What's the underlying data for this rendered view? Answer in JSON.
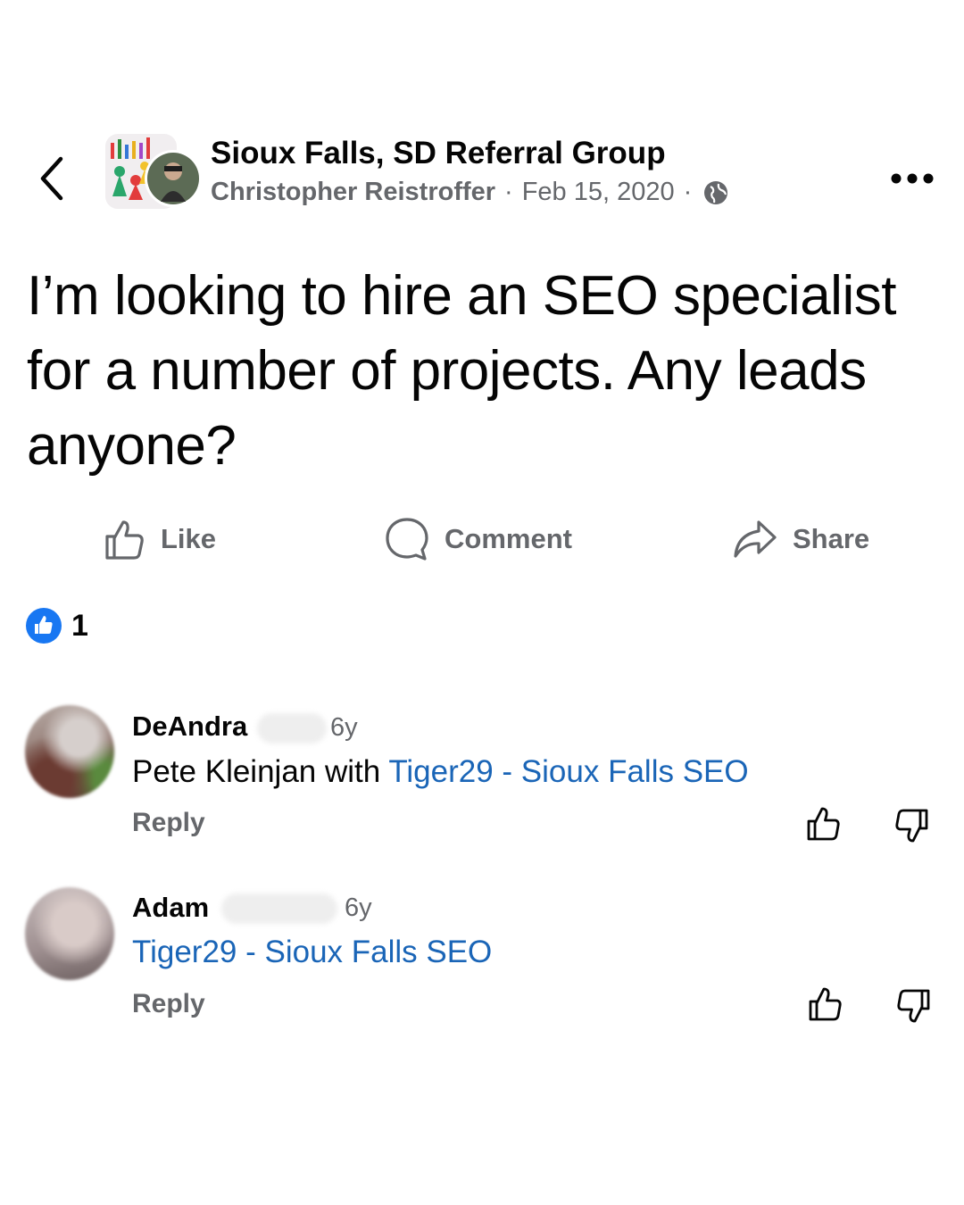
{
  "header": {
    "group_name": "Sioux Falls, SD Referral Group",
    "author": "Christopher Reistroffer",
    "separator": "·",
    "date": "Feb 15, 2020",
    "privacy_icon": "globe-icon",
    "back_icon": "chevron-left-icon",
    "more_icon": "more-horizontal-icon"
  },
  "post": {
    "text": "I’m looking to hire an SEO specialist for a number of projects. Any leads anyone?"
  },
  "actions": {
    "like": "Like",
    "comment": "Comment",
    "share": "Share"
  },
  "reactions": {
    "count": "1",
    "icon": "like-reaction-icon",
    "color": "#1877f2"
  },
  "comments": [
    {
      "name": "DeAndra",
      "time": "6y",
      "text_prefix": "Pete Kleinjan with ",
      "link_text": "Tiger29 - Sioux Falls SEO",
      "reply": "Reply"
    },
    {
      "name": "Adam",
      "time": "6y",
      "text_prefix": "",
      "link_text": "Tiger29 - Sioux Falls SEO",
      "reply": "Reply"
    }
  ],
  "colors": {
    "text": "#050505",
    "secondary": "#65676b",
    "link": "#1a65b7",
    "accent": "#1877f2"
  }
}
